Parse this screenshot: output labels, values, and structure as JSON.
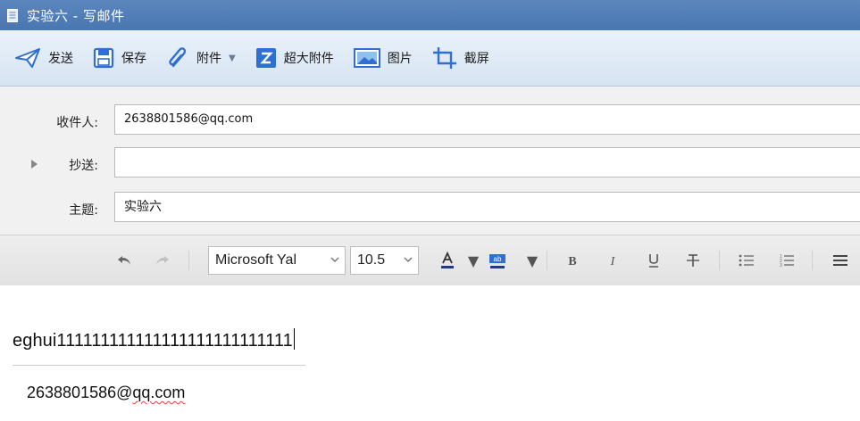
{
  "window": {
    "title": "实验六 - 写邮件",
    "icon": "document-icon"
  },
  "toolbar": {
    "send_label": "发送",
    "save_label": "保存",
    "attach_label": "附件",
    "large_attach_label": "超大附件",
    "image_label": "图片",
    "screenshot_label": "截屏"
  },
  "fields": {
    "to_label": "收件人:",
    "to_value": "2638801586@qq.com",
    "cc_label": "抄送:",
    "cc_value": "",
    "subject_label": "主题:",
    "subject_value": "实验六"
  },
  "format_bar": {
    "font_family": "Microsoft Yal",
    "font_size": "10.5",
    "icons": [
      "undo-icon",
      "redo-icon",
      "font-color-icon",
      "highlight-color-icon",
      "bold-icon",
      "italic-icon",
      "underline-icon",
      "strikethrough-icon",
      "bullet-list-icon",
      "numbered-list-icon",
      "align-icon"
    ]
  },
  "body": {
    "text": "eghui111111111111111111111111111",
    "signature_prefix": "2638801586@",
    "signature_suffix": "qq.com"
  },
  "colors": {
    "titlebar": "#4a76b0",
    "toolbar_icon_blue": "#2f6fd1",
    "spellcheck": "#e23b3b"
  }
}
